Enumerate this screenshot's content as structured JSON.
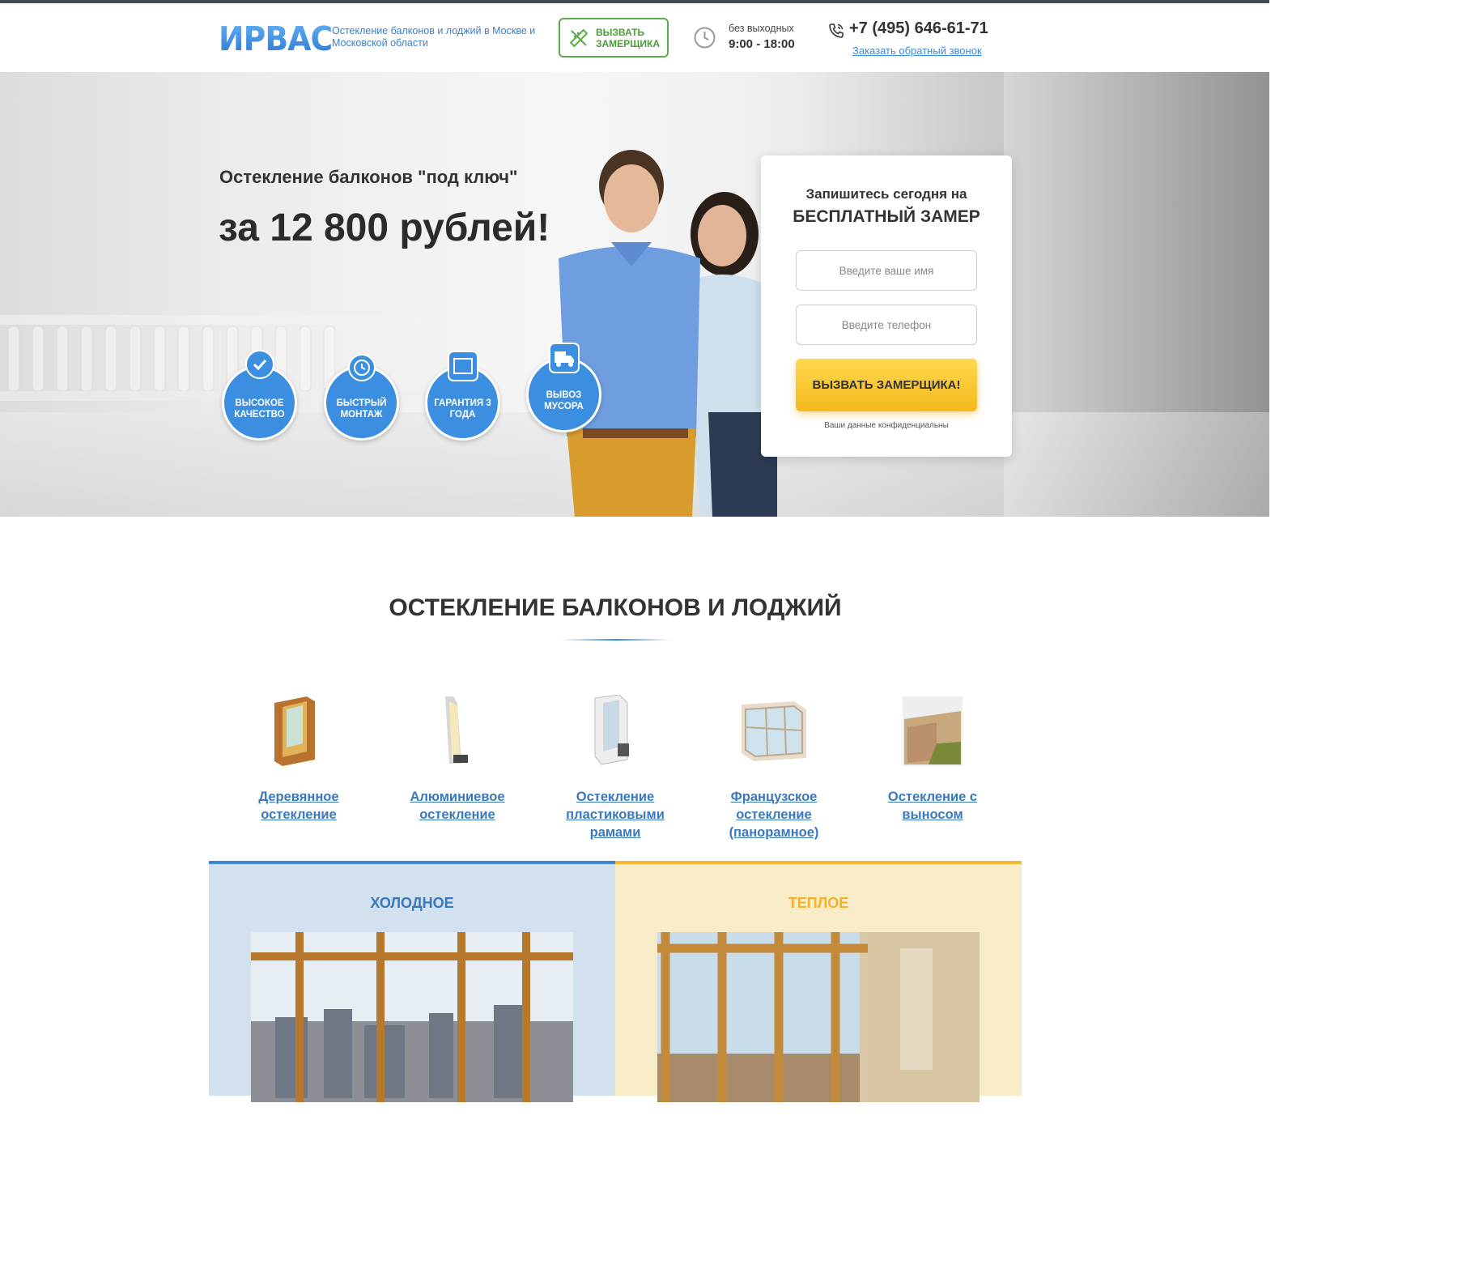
{
  "header": {
    "logo": "ИРВАС",
    "tagline": "Остекление балконов и лоджий в Москве и Московской области",
    "call_button": "Вызвать замерщика",
    "hours_label": "без выходных",
    "hours_value": "9:00 - 18:00",
    "phone": "+7 (495) 646-61-71",
    "callback_link": "Заказать обратный звонок"
  },
  "hero": {
    "subtitle": "Остекление балконов \"под ключ\"",
    "title": "за 12 800 рублей!",
    "badges": [
      {
        "label": "Высокое качество",
        "icon": "award-icon"
      },
      {
        "label": "Быстрый монтаж",
        "icon": "stopwatch-icon"
      },
      {
        "label": "Гарантия 3 года",
        "icon": "calendar-icon"
      },
      {
        "label": "Вывоз мусора",
        "icon": "truck-icon"
      }
    ]
  },
  "form": {
    "title_line1": "Запишитесь сегодня на",
    "title_line2": "БЕСПЛАТНЫЙ ЗАМЕР",
    "name_placeholder": "Введите ваше имя",
    "phone_placeholder": "Введите телефон",
    "submit": "Вызвать замерщика!",
    "privacy": "Ваши данные конфиденциальны"
  },
  "glazing": {
    "title": "ОСТЕКЛЕНИЕ БАЛКОНОВ И ЛОДЖИЙ",
    "types": [
      {
        "label": "Деревянное остекление"
      },
      {
        "label": "Алюминиевое остекление"
      },
      {
        "label": "Остекление пластиковыми рамами"
      },
      {
        "label": "Французское остекление (панорамное)"
      },
      {
        "label": "Остекление с выносом"
      }
    ],
    "panels": [
      {
        "label": "Холодное",
        "accent": "#3b86d6",
        "bg": "#d3e0ee",
        "label_color": "#3a78be"
      },
      {
        "label": "Теплое",
        "accent": "#f3b92c",
        "bg": "#f8ebc8",
        "label_color": "#f0b22a"
      }
    ]
  },
  "colors": {
    "brand_blue": "#3c8fe0",
    "green": "#5aad46",
    "yellow": "#f4b91c"
  }
}
